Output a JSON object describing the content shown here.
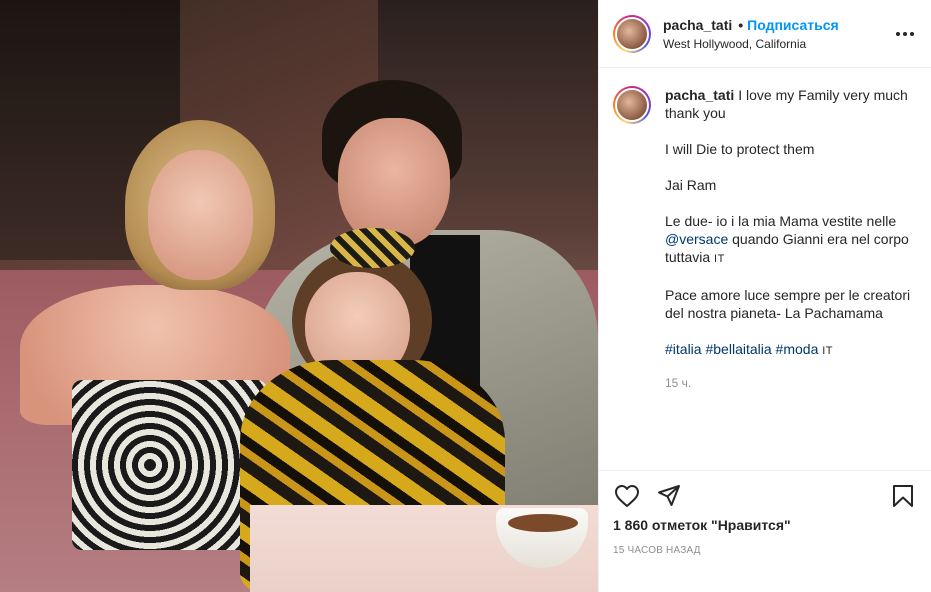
{
  "header": {
    "username": "pacha_tati",
    "separator": "•",
    "follow_label": "Подписаться",
    "location": "West Hollywood, California",
    "more_icon": "more-horizontal-icon"
  },
  "caption": {
    "username": "pacha_tati",
    "line1": "I love my Family very much thank you",
    "line2": "I will Die to protect them",
    "line3": "Jai Ram",
    "line4_pre": "Le due- io i la mia Mama vestite nelle ",
    "line4_link": "@versace",
    "line4_post": " quando Gianni era nel corpo tuttavia ",
    "line4_flag": "IT",
    "line5": "Pace amore luce sempre per le creatori del nostra pianeta- La Pachamama",
    "hashtags": [
      "#italia",
      "#bellaitalia",
      "#moda"
    ],
    "hashtag_flag": "IT",
    "time": "15 ч."
  },
  "actions": {
    "like_icon": "heart-icon",
    "share_icon": "send-icon",
    "save_icon": "bookmark-icon",
    "likes_text": "1 860 отметок \"Нравится\"",
    "posted": "15 ЧАСОВ НАЗАД"
  },
  "colors": {
    "link": "#00376b",
    "follow": "#0095f6",
    "muted": "#8e8e8e"
  }
}
